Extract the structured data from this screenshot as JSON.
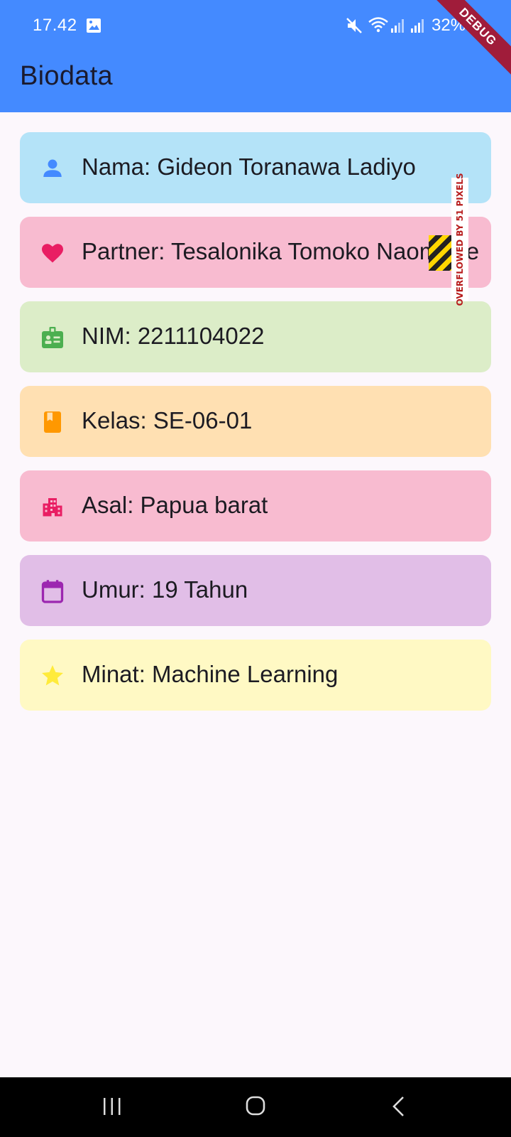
{
  "status_bar": {
    "time": "17.42",
    "battery": "32%"
  },
  "app_bar": {
    "title": "Biodata",
    "debug_banner": "DEBUG"
  },
  "cards": [
    {
      "text": "Nama: Gideon Toranawa Ladiyo",
      "icon": "person-icon",
      "bg": "#b4e3f8",
      "icon_color": "#448aff"
    },
    {
      "text": "Partner: Tesalonika Tomoko Naomi Pe",
      "icon": "heart-icon",
      "bg": "#f8bbd0",
      "icon_color": "#e91e63"
    },
    {
      "text": "NIM: 2211104022",
      "icon": "badge-icon",
      "bg": "#dcedc8",
      "icon_color": "#4caf50"
    },
    {
      "text": "Kelas: SE-06-01",
      "icon": "book-icon",
      "bg": "#ffe0b2",
      "icon_color": "#ff9800"
    },
    {
      "text": "Asal: Papua barat",
      "icon": "city-icon",
      "bg": "#f8bbd0",
      "icon_color": "#e91e63"
    },
    {
      "text": "Umur: 19 Tahun",
      "icon": "calendar-icon",
      "bg": "#e1bee7",
      "icon_color": "#9c27b0"
    },
    {
      "text": "Minat: Machine Learning",
      "icon": "star-icon",
      "bg": "#fff9c4",
      "icon_color": "#ffeb3b"
    }
  ],
  "overflow_warning": "OVERFLOWED BY 51 PIXELS"
}
